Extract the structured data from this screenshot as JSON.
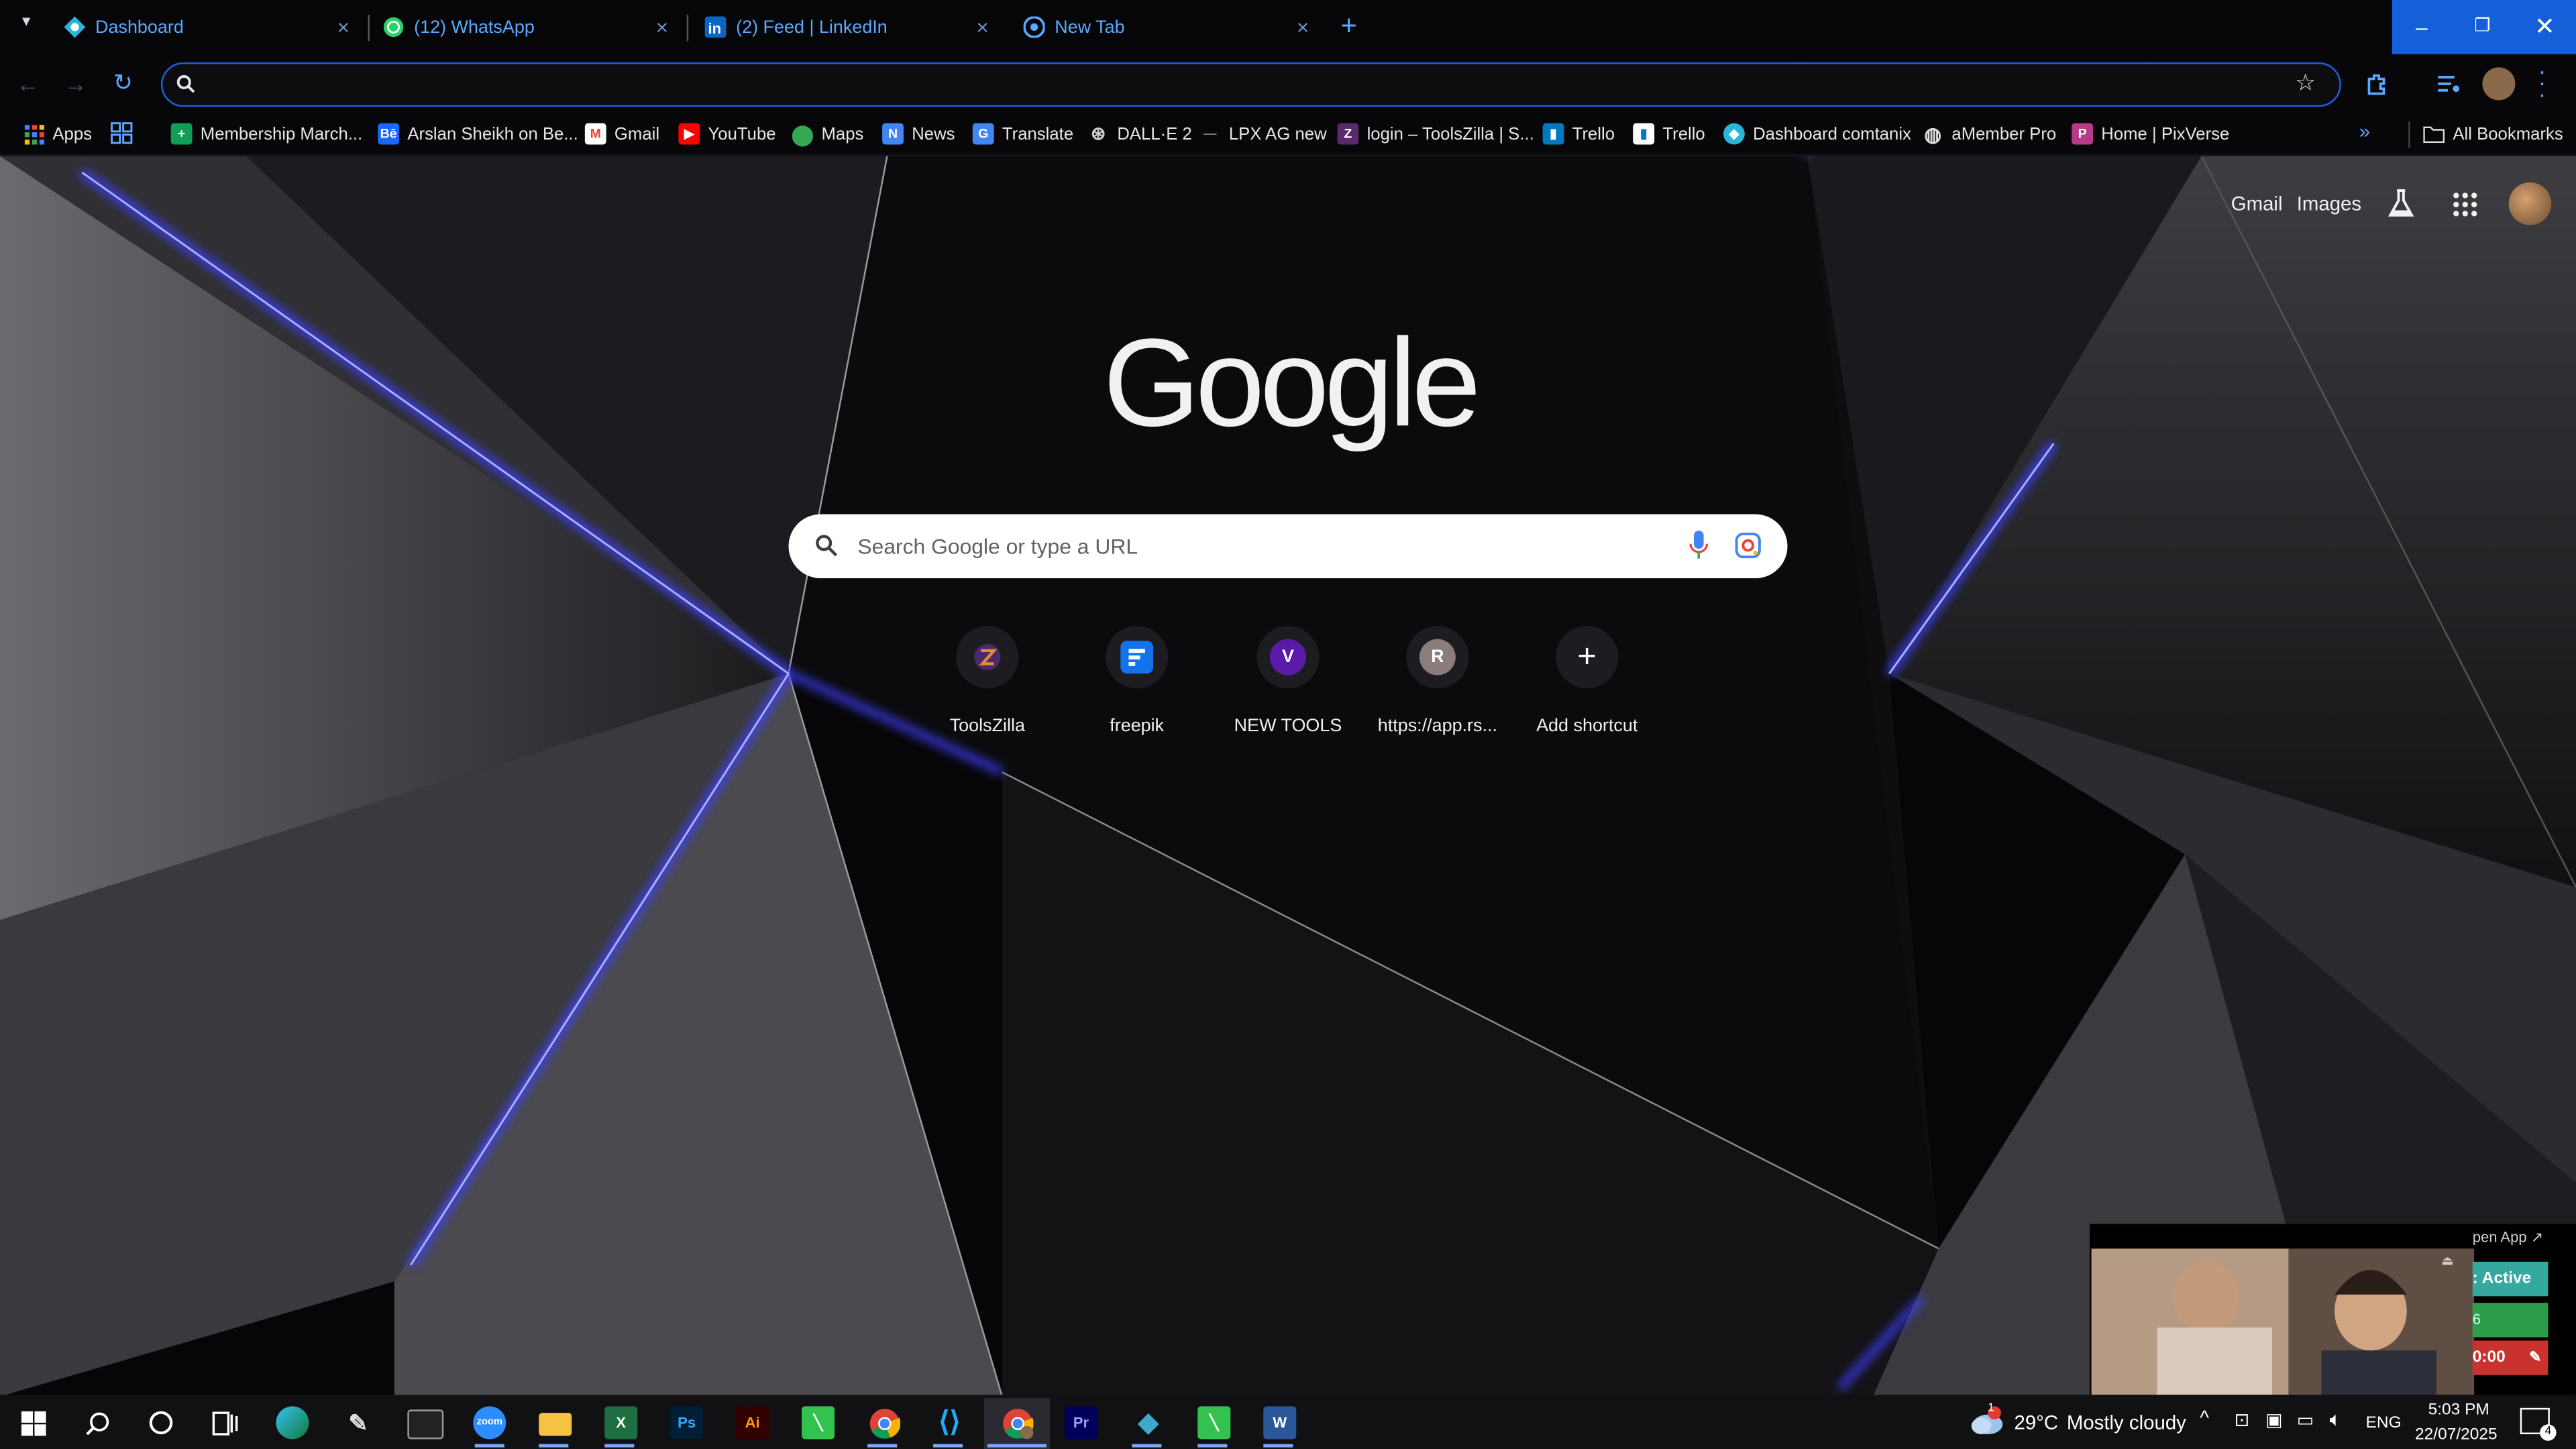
{
  "browser": {
    "tabs": [
      {
        "title": "Dashboard",
        "icon": "cloud-favicon-icon"
      },
      {
        "title": "(12) WhatsApp",
        "icon": "whatsapp-icon"
      },
      {
        "title": "(2) Feed | LinkedIn",
        "icon": "linkedin-icon"
      },
      {
        "title": "New Tab",
        "icon": "chrome-icon"
      }
    ],
    "omnibox": {
      "value": "",
      "placeholder": ""
    },
    "bookmarks": [
      {
        "label": "Apps",
        "icon": "apps-grid-icon"
      },
      {
        "label": "Membership March...",
        "icon": "sheets-icon"
      },
      {
        "label": "Arslan Sheikh on Be...",
        "icon": "behance-icon"
      },
      {
        "label": "Gmail",
        "icon": "gmail-icon"
      },
      {
        "label": "YouTube",
        "icon": "youtube-icon"
      },
      {
        "label": "Maps",
        "icon": "maps-icon"
      },
      {
        "label": "News",
        "icon": "news-icon"
      },
      {
        "label": "Translate",
        "icon": "translate-icon"
      },
      {
        "label": "DALL·E 2",
        "icon": "openai-icon"
      },
      {
        "label": "LPX AG new",
        "icon": "dash-icon"
      },
      {
        "label": "login – ToolsZilla | S...",
        "icon": "toolszilla-icon"
      },
      {
        "label": "Trello",
        "icon": "trello-icon"
      },
      {
        "label": "Trello",
        "icon": "trello-icon"
      },
      {
        "label": "Dashboard comtanix",
        "icon": "cloud-favicon-icon"
      },
      {
        "label": "aMember Pro",
        "icon": "globe-icon"
      },
      {
        "label": "Home | PixVerse",
        "icon": "pixverse-icon"
      }
    ],
    "all_bookmarks": "All Bookmarks"
  },
  "newtab": {
    "top_links": {
      "gmail": "Gmail",
      "images": "Images"
    },
    "logo": "Google",
    "search_placeholder": "Search Google or type a URL",
    "shortcuts": [
      {
        "label": "ToolsZilla",
        "glyph": ""
      },
      {
        "label": "freepik",
        "glyph": ""
      },
      {
        "label": "NEW TOOLS",
        "glyph": "V"
      },
      {
        "label": "https://app.rs...",
        "glyph": "R"
      },
      {
        "label": "Add shortcut",
        "glyph": "+"
      }
    ]
  },
  "video_overlay": {
    "open_app": "pen App ↗",
    "status_active": ": Active",
    "status_num": "6",
    "status_time": "0:00"
  },
  "taskbar": {
    "weather": {
      "temp": "29°C",
      "desc": "Mostly cloudy",
      "alert": "1"
    },
    "lang": "ENG",
    "time": "5:03 PM",
    "date": "22/07/2025",
    "notif_count": "4",
    "apps": [
      "start",
      "search",
      "cortana",
      "task-view",
      "edge",
      "pen",
      "terminal",
      "zoom",
      "file-explorer",
      "excel",
      "photoshop",
      "illustrator",
      "green-app",
      "chrome",
      "vscode",
      "chrome-active",
      "premiere",
      "kite",
      "green-app-2",
      "word"
    ]
  },
  "colors": {
    "accent": "#1f5fe0",
    "tab_text": "#5aa9ff",
    "blue_glow": "#3a3cff"
  }
}
